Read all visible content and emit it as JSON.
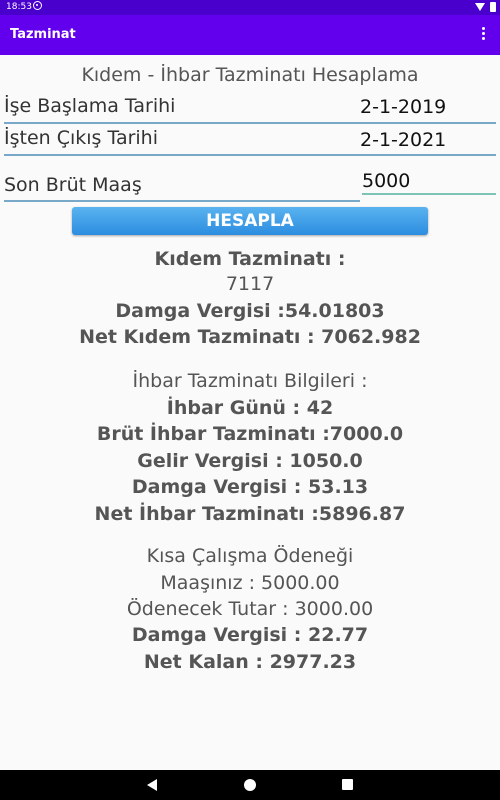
{
  "status": {
    "time": "18:53"
  },
  "appbar": {
    "title": "Tazminat"
  },
  "form": {
    "heading": "Kıdem - İhbar Tazminatı Hesaplama",
    "start_label": "İşe Başlama Tarihi",
    "start_value": "2-1-2019",
    "end_label": "İşten Çıkış Tarihi",
    "end_value": "2-1-2021",
    "salary_label": "Son Brüt Maaş",
    "salary_value": "5000",
    "button": "HESAPLA"
  },
  "results": {
    "kidem_title": "Kıdem Tazminatı :",
    "kidem_value": "7117",
    "kidem_stamp": "Damga Vergisi :54.01803",
    "kidem_net": "Net Kıdem Tazminatı : 7062.982",
    "ihbar_title": "İhbar Tazminatı Bilgileri :",
    "ihbar_days": "İhbar Günü : 42",
    "ihbar_gross": "Brüt İhbar Tazminatı :7000.0",
    "ihbar_income_tax": "Gelir Vergisi : 1050.0",
    "ihbar_stamp": "Damga Vergisi : 53.13",
    "ihbar_net": "Net İhbar Tazminatı :5896.87",
    "kisa_title": "Kısa Çalışma Ödeneği",
    "kisa_salary": "Maaşınız : 5000.00",
    "kisa_payable": "Ödenecek Tutar : 3000.00",
    "kisa_stamp": "Damga Vergisi : 22.77",
    "kisa_net": "Net Kalan : 2977.23"
  },
  "icons": [
    "sync-icon",
    "wifi-icon",
    "battery-icon",
    "overflow-menu-icon",
    "nav-back-icon",
    "nav-home-icon",
    "nav-recents-icon"
  ]
}
